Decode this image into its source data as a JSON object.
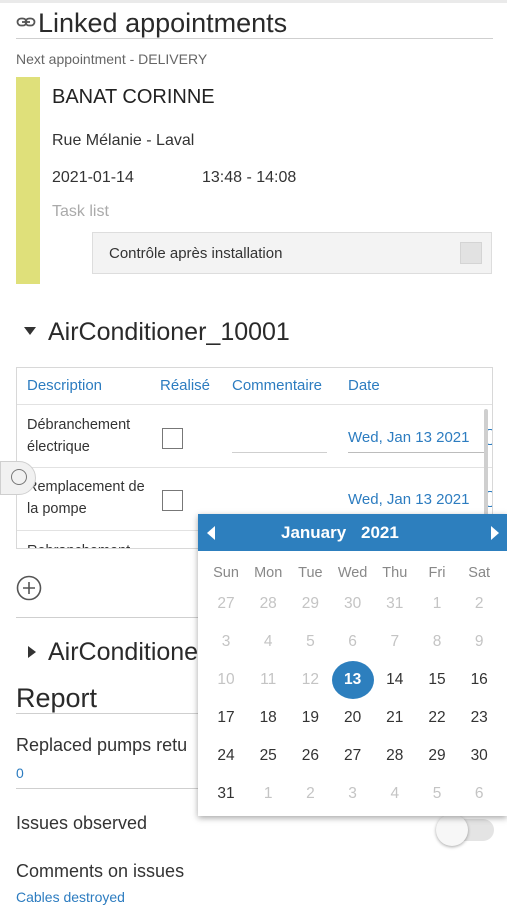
{
  "header": {
    "title": "Linked appointments",
    "icon": "link-icon"
  },
  "appointment": {
    "label": "Next appointment - DELIVERY",
    "customer": "BANAT CORINNE",
    "address": "Rue Mélanie - Laval",
    "date": "2021-01-14",
    "time": "13:48 - 14:08",
    "task_list_label": "Task list",
    "tasks": [
      {
        "label": "Contrôle après installation",
        "checked": false
      }
    ],
    "accent_color": "#dfe07a"
  },
  "equipment1": {
    "title": "AirConditioner_10001",
    "expanded": true,
    "columns": [
      "Description",
      "Réalisé",
      "Commentaire",
      "Date"
    ],
    "rows": [
      {
        "description": "Débranchement électrique",
        "done": false,
        "comment": "",
        "date": "Wed, Jan 13 2021"
      },
      {
        "description": "Remplacement de la pompe",
        "done": false,
        "comment": "",
        "date": "Wed, Jan 13 2021"
      },
      {
        "description": "Rebranchement",
        "done": false,
        "comment": "",
        "date": ""
      }
    ]
  },
  "equipment2": {
    "title": "AirConditioner",
    "expanded": false
  },
  "report": {
    "title": "Report",
    "fields": [
      {
        "label": "Replaced pumps retu",
        "value": "0"
      },
      {
        "label": "Issues observed",
        "toggle": false
      },
      {
        "label": "Comments on issues",
        "value": "Cables destroyed"
      }
    ]
  },
  "calendar": {
    "month": "January",
    "year": "2021",
    "weekdays": [
      "Sun",
      "Mon",
      "Tue",
      "Wed",
      "Thu",
      "Fri",
      "Sat"
    ],
    "weeks": [
      [
        "27",
        "28",
        "29",
        "30",
        "31",
        "1",
        "2"
      ],
      [
        "3",
        "4",
        "5",
        "6",
        "7",
        "8",
        "9"
      ],
      [
        "10",
        "11",
        "12",
        "13",
        "14",
        "15",
        "16"
      ],
      [
        "17",
        "18",
        "19",
        "20",
        "21",
        "22",
        "23"
      ],
      [
        "24",
        "25",
        "26",
        "27",
        "28",
        "29",
        "30"
      ],
      [
        "31",
        "1",
        "2",
        "3",
        "4",
        "5",
        "6"
      ]
    ],
    "selected": "13",
    "accent_color": "#2d7fbe"
  }
}
